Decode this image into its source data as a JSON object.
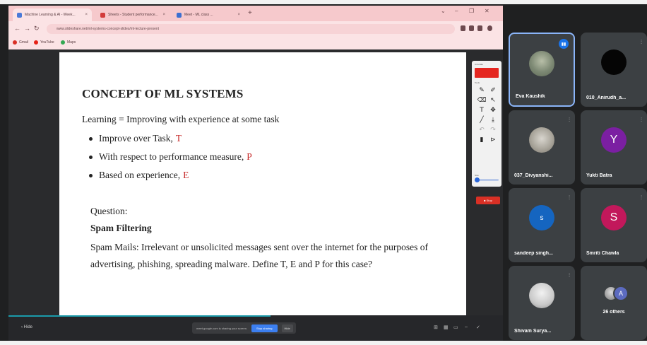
{
  "browser": {
    "tabs": [
      {
        "title": "Machine Learning & AI - Week...",
        "close": "×"
      },
      {
        "title": "Sheets - Student performance...",
        "close": "×"
      },
      {
        "title": "Meet - ML class ...",
        "close": "×"
      }
    ],
    "new_tab": "+",
    "window_controls": [
      "⌄",
      "–",
      "❐",
      "✕"
    ],
    "url": "www.slideshare.net/ml-systems-concept-slides/ml-lecture-present",
    "bookmarks": [
      "Gmail",
      "YouTube",
      "Maps"
    ]
  },
  "slide": {
    "title": "CONCEPT OF ML SYSTEMS",
    "intro": "Learning = Improving with experience at some task",
    "bullets": [
      {
        "text": "Improve over Task,",
        "accent": "T"
      },
      {
        "text": "With respect to performance measure,",
        "accent": "P"
      },
      {
        "text": "Based on experience,",
        "accent": "E"
      }
    ],
    "question_label": "Question:",
    "question_topic": "Spam Filtering",
    "question_text": "Spam Mails: Irrelevant or unsolicited messages sent over the internet for the purposes of advertising, phishing, spreading malware. Define T, E and P for this case?"
  },
  "annotation_toolbar": {
    "header": "Annotate",
    "section": "Tools",
    "size_label": "Size",
    "stop_label": "■ Stop",
    "colors": {
      "pen": "#e52620"
    }
  },
  "share_bar": {
    "back": "‹ Hide",
    "message": "meet.google.com is sharing your screen.",
    "stop_button": "Stop sharing",
    "hide_button": "Hide",
    "progress_fraction": 0.53
  },
  "participants": [
    {
      "name": "Eva Kaushik",
      "avatar": "photo",
      "speaking": true
    },
    {
      "name": "010_Anirudh_a...",
      "avatar": "black",
      "speaking": false
    },
    {
      "name": "037_Divyanshi...",
      "avatar": "photo2",
      "speaking": false
    },
    {
      "name": "Yukti Batra",
      "avatar": "Y",
      "speaking": false
    },
    {
      "name": "sandeep singh...",
      "avatar": "s",
      "speaking": false
    },
    {
      "name": "Smriti Chawla",
      "avatar": "S",
      "speaking": false
    },
    {
      "name": "Shivam Surya...",
      "avatar": "photo3",
      "speaking": false
    },
    {
      "name": "26 others",
      "avatar": "A",
      "speaking": false
    }
  ]
}
